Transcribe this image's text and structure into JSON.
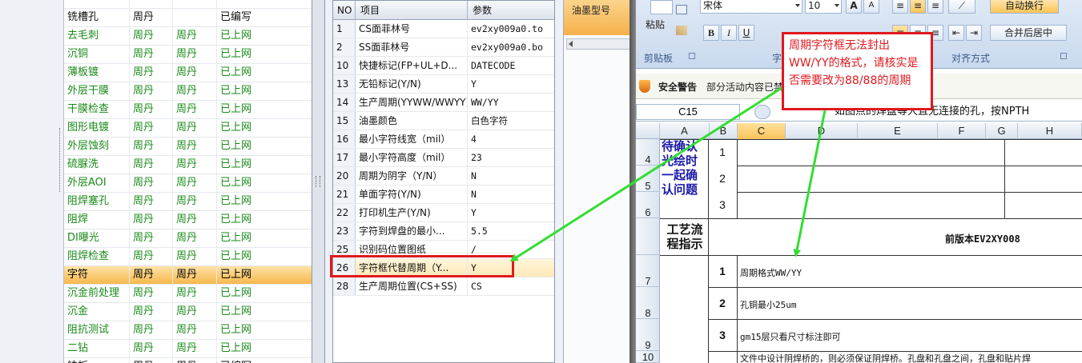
{
  "process_list": {
    "rows": [
      {
        "name": "",
        "c1": "",
        "c2": "",
        "status": "",
        "style": "partial"
      },
      {
        "name": "铣槽孔",
        "c1": "周丹",
        "c2": "",
        "status": "已编写",
        "style": "black"
      },
      {
        "name": "去毛刺",
        "c1": "周丹",
        "c2": "周丹",
        "status": "已上网",
        "style": "green"
      },
      {
        "name": "沉铜",
        "c1": "周丹",
        "c2": "周丹",
        "status": "已上网",
        "style": "green"
      },
      {
        "name": "薄板镀",
        "c1": "周丹",
        "c2": "周丹",
        "status": "已上网",
        "style": "green"
      },
      {
        "name": "外层干膜",
        "c1": "周丹",
        "c2": "周丹",
        "status": "已上网",
        "style": "green"
      },
      {
        "name": "干膜检查",
        "c1": "周丹",
        "c2": "周丹",
        "status": "已上网",
        "style": "green"
      },
      {
        "name": "图形电镀",
        "c1": "周丹",
        "c2": "周丹",
        "status": "已上网",
        "style": "green"
      },
      {
        "name": "外层蚀刻",
        "c1": "周丹",
        "c2": "周丹",
        "status": "已上网",
        "style": "green"
      },
      {
        "name": "硫脲洗",
        "c1": "周丹",
        "c2": "周丹",
        "status": "已上网",
        "style": "green"
      },
      {
        "name": "外层AOI",
        "c1": "周丹",
        "c2": "周丹",
        "status": "已上网",
        "style": "green"
      },
      {
        "name": "阻焊塞孔",
        "c1": "周丹",
        "c2": "周丹",
        "status": "已上网",
        "style": "green"
      },
      {
        "name": "阻焊",
        "c1": "周丹",
        "c2": "周丹",
        "status": "已上网",
        "style": "green"
      },
      {
        "name": "DI曝光",
        "c1": "周丹",
        "c2": "周丹",
        "status": "已上网",
        "style": "green"
      },
      {
        "name": "阻焊检查",
        "c1": "周丹",
        "c2": "周丹",
        "status": "已上网",
        "style": "green"
      },
      {
        "name": "字符",
        "c1": "周丹",
        "c2": "周丹",
        "status": "已上网",
        "style": "selected"
      },
      {
        "name": "沉金前处理",
        "c1": "周丹",
        "c2": "周丹",
        "status": "已上网",
        "style": "green"
      },
      {
        "name": "沉金",
        "c1": "周丹",
        "c2": "周丹",
        "status": "已上网",
        "style": "green"
      },
      {
        "name": "阻抗测试",
        "c1": "周丹",
        "c2": "周丹",
        "status": "已上网",
        "style": "green"
      },
      {
        "name": "二钻",
        "c1": "周丹",
        "c2": "周丹",
        "status": "已上网",
        "style": "green"
      },
      {
        "name": "铣板",
        "c1": "周丹",
        "c2": "周丹",
        "status": "已编写",
        "style": "black"
      }
    ]
  },
  "params": {
    "headers": {
      "no": "NO",
      "item": "项目",
      "value": "参数"
    },
    "rows": [
      {
        "no": "1",
        "item": "CS面菲林号",
        "value": "ev2xy009a0.to"
      },
      {
        "no": "2",
        "item": "SS面菲林号",
        "value": "ev2xy009a0.bo"
      },
      {
        "no": "10",
        "item": "快捷标记(FP+UL+D...",
        "value": "DATECODE"
      },
      {
        "no": "13",
        "item": "无铅标记(Y/N)",
        "value": "Y"
      },
      {
        "no": "14",
        "item": "生产周期(YYWW/WWYY)",
        "value": "WW/YY"
      },
      {
        "no": "15",
        "item": "油墨颜色",
        "value": "白色字符"
      },
      {
        "no": "16",
        "item": "最小字符线宽（mil）",
        "value": "4"
      },
      {
        "no": "17",
        "item": "最小字符高度（mil）",
        "value": "23"
      },
      {
        "no": "20",
        "item": "周期为阴字（Y/N）",
        "value": "N"
      },
      {
        "no": "21",
        "item": "单面字符(Y/N)",
        "value": "N"
      },
      {
        "no": "22",
        "item": "打印机生产(Y/N)",
        "value": "Y"
      },
      {
        "no": "23",
        "item": "字符到焊盘的最小...",
        "value": "5.5"
      },
      {
        "no": "25",
        "item": "识别码位置图纸",
        "value": "/"
      },
      {
        "no": "26",
        "item": "字符框代替周期（Y...",
        "value": "Y"
      },
      {
        "no": "28",
        "item": "生产周期位置(CS+SS)",
        "value": "CS"
      }
    ]
  },
  "ink_panel": {
    "header": "油墨型号"
  },
  "excel": {
    "font_name": "宋体",
    "font_size": "10",
    "paste_label": "粘贴",
    "wrap_label": "自动换行",
    "merge_label": "合并后居中",
    "clipboard_group": "剪贴板",
    "font_group": "字",
    "align_group": "对齐方式",
    "security_title": "安全警告",
    "security_text": "部分活动内容已禁",
    "name_box": "C15",
    "formula": "如图点的焊盘等大且无连接的孔，按NPTH",
    "columns": [
      "A",
      "B",
      "C",
      "D",
      "E",
      "F",
      "G",
      "H"
    ],
    "rows": [
      "4",
      "5",
      "6",
      "7",
      "8",
      "9",
      "10"
    ],
    "confirm_label": "待确认光绘时一起确认问题",
    "confirm_nums": [
      "1",
      "2",
      "3"
    ],
    "process_label": "工艺流程指示",
    "prev_version": "前版本EV2XY008",
    "steps": [
      {
        "num": "1",
        "text": "周期格式WW/YY"
      },
      {
        "num": "2",
        "text": "孔铜最小25um"
      },
      {
        "num": "3",
        "text": "gm15层只看尺寸标注即可"
      }
    ],
    "bottom_text": "文件中设计阴焊桥的，则必须保证阴焊桥。孔盘和孔盘之间，孔盘和贴片焊"
  },
  "annotation": {
    "text": "周期字符框无法封出WW/YY的格式，请核实是否需要改为88/88的周期",
    "color": "#e0191e",
    "arrow_color": "#33dd33"
  }
}
